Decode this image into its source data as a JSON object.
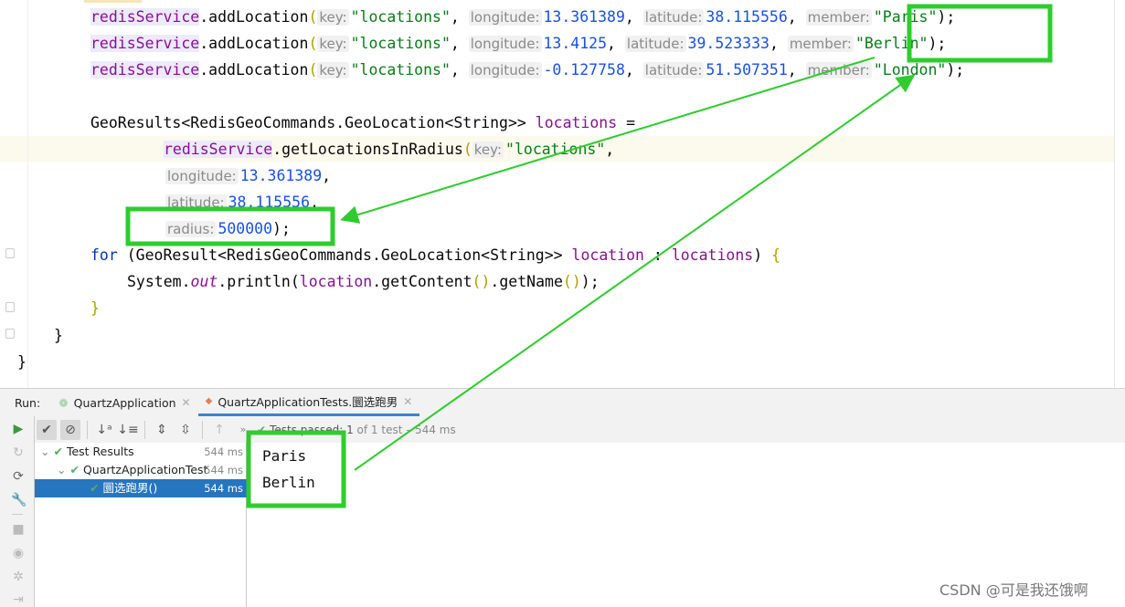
{
  "editor": {
    "lines": [
      [
        [
          "svc",
          "redisService"
        ],
        [
          "p",
          ".addLocation"
        ],
        [
          "par",
          "("
        ],
        [
          "hint",
          "key:"
        ],
        [
          "str",
          "\"locations\""
        ],
        [
          "p",
          ", "
        ],
        [
          "hint",
          "longitude:"
        ],
        [
          "num",
          "13.361389"
        ],
        [
          "p",
          ", "
        ],
        [
          "hint",
          "latitude:"
        ],
        [
          "num",
          "38.115556"
        ],
        [
          "p",
          ", "
        ],
        [
          "hint",
          "member:"
        ],
        [
          "str",
          "\"Paris\""
        ],
        [
          "p",
          ");"
        ]
      ],
      [
        [
          "svc",
          "redisService"
        ],
        [
          "p",
          ".addLocation"
        ],
        [
          "par",
          "("
        ],
        [
          "hint",
          "key:"
        ],
        [
          "str",
          "\"locations\""
        ],
        [
          "p",
          ", "
        ],
        [
          "hint",
          "longitude:"
        ],
        [
          "num",
          "13.4125"
        ],
        [
          "p",
          ", "
        ],
        [
          "hint",
          "latitude:"
        ],
        [
          "num",
          "39.523333"
        ],
        [
          "p",
          ", "
        ],
        [
          "hint",
          "member:"
        ],
        [
          "str",
          "\"Berlin\""
        ],
        [
          "p",
          ");"
        ]
      ],
      [
        [
          "svc",
          "redisService"
        ],
        [
          "p",
          ".addLocation"
        ],
        [
          "par",
          "("
        ],
        [
          "hint",
          "key:"
        ],
        [
          "str",
          "\"locations\""
        ],
        [
          "p",
          ", "
        ],
        [
          "hint",
          "longitude:"
        ],
        [
          "num",
          "-0.127758"
        ],
        [
          "p",
          ", "
        ],
        [
          "hint",
          "latitude:"
        ],
        [
          "num",
          "51.507351"
        ],
        [
          "p",
          ", "
        ],
        [
          "hint",
          "member:"
        ],
        [
          "str",
          "\"London\""
        ],
        [
          "p",
          ");"
        ]
      ],
      [],
      [
        [
          "p",
          "GeoResults<RedisGeoCommands.GeoLocation<String>> "
        ],
        [
          "fld",
          "locations"
        ],
        [
          "p",
          " ="
        ]
      ],
      [
        [
          "svc",
          "redisService"
        ],
        [
          "p",
          ".getLocationsInRadius"
        ],
        [
          "par",
          "("
        ],
        [
          "hint",
          "key:"
        ],
        [
          "str",
          "\"locations\""
        ],
        [
          "p",
          ","
        ]
      ],
      [
        [
          "hint",
          "longitude:"
        ],
        [
          "num",
          "13.361389"
        ],
        [
          "p",
          ","
        ]
      ],
      [
        [
          "hint",
          "latitude:"
        ],
        [
          "num",
          "38.115556"
        ],
        [
          "p",
          ","
        ]
      ],
      [
        [
          "hint",
          "radius:"
        ],
        [
          "num",
          "500000"
        ],
        [
          "p",
          ");"
        ]
      ],
      [
        [
          "kw",
          "for"
        ],
        [
          "p",
          " (GeoResult<RedisGeoCommands.GeoLocation<String>> "
        ],
        [
          "fld",
          "location"
        ],
        [
          "p",
          " : "
        ],
        [
          "fld",
          "locations"
        ],
        [
          "p",
          ") "
        ],
        [
          "par",
          "{"
        ]
      ],
      [
        [
          "p",
          "System."
        ],
        [
          "it",
          "out"
        ],
        [
          "p",
          ".println("
        ],
        [
          "fld",
          "location"
        ],
        [
          "p",
          ".getContent"
        ],
        [
          "par",
          "()"
        ],
        [
          "p",
          ".getName"
        ],
        [
          "par",
          "()"
        ],
        [
          "p",
          ");"
        ]
      ],
      [
        [
          "par",
          "}"
        ]
      ],
      [
        [
          "p",
          "}"
        ]
      ],
      [
        [
          "p",
          "}"
        ]
      ]
    ]
  },
  "run": {
    "label": "Run:",
    "tabs": [
      {
        "label": "QuartzApplication",
        "icon": "spring-boot-icon"
      },
      {
        "label": "QuartzApplicationTests.圜选跑男",
        "icon": "junit-icon"
      }
    ],
    "status_prefix": "Tests passed: ",
    "status_count": "1",
    "status_suffix": " of 1 test – 544 ms",
    "tree": [
      {
        "label": "Test Results",
        "time": "544 ms"
      },
      {
        "label": "QuartzApplicationTest",
        "time": "544 ms"
      },
      {
        "label": "圜选跑男()",
        "time": "544 ms"
      }
    ],
    "console": [
      "Paris",
      "Berlin"
    ]
  },
  "watermark": "CSDN @可是我还饿啊",
  "colors": {
    "annotation": "#2ecc2e",
    "selection": "#2675bf",
    "pass": "#59a869"
  }
}
